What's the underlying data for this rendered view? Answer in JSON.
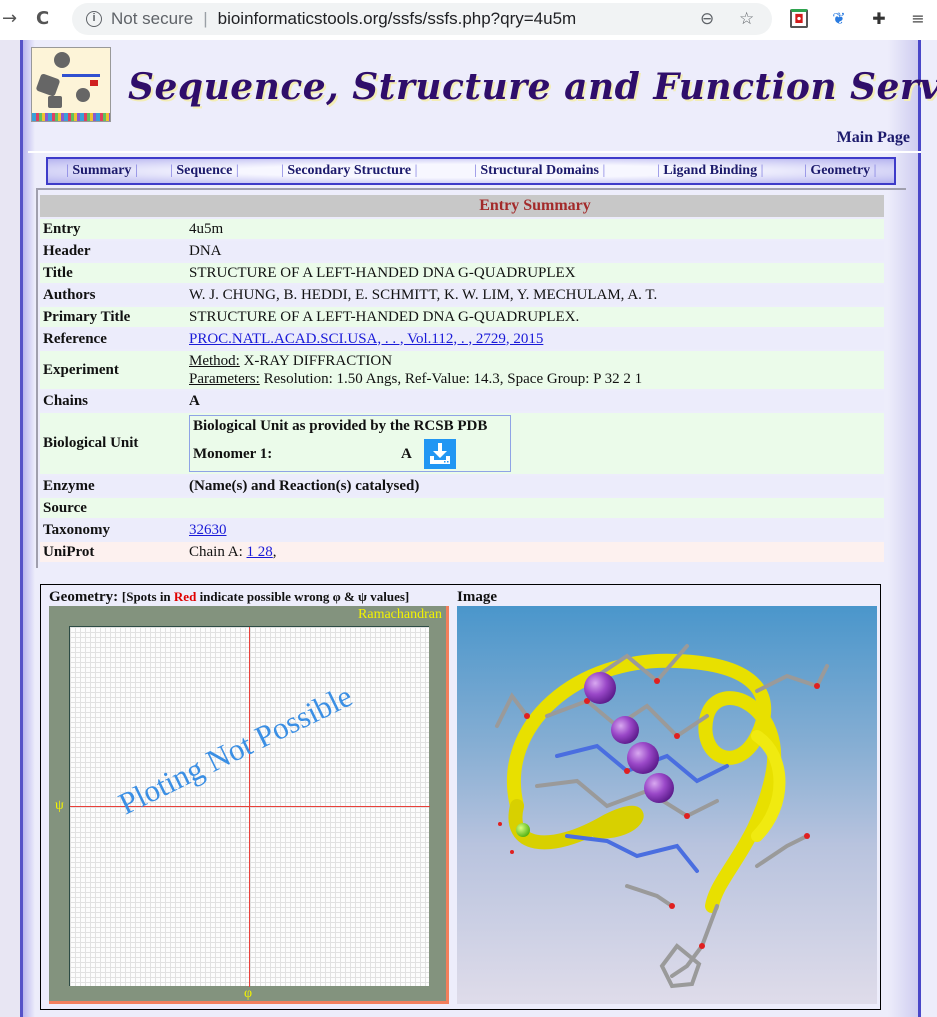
{
  "browser": {
    "back_icon": "→",
    "reload_icon": "C",
    "security_label": "Not secure",
    "url": "bioinformaticstools.org/ssfs/ssfs.php?qry=4u5m",
    "icons": [
      "zoom-out-icon",
      "bookmark-star-icon",
      "mcafee-extension-icon",
      "feather-extension-icon",
      "extensions-puzzle-icon",
      "media-queue-icon"
    ]
  },
  "header": {
    "site_title": "Sequence, Structure and Function Server",
    "main_page_link": "Main Page"
  },
  "nav": {
    "items": [
      {
        "label": "Summary"
      },
      {
        "label": "Sequence"
      },
      {
        "label": "Secondary Structure"
      },
      {
        "label": "Structural Domains"
      },
      {
        "label": "Ligand Binding"
      },
      {
        "label": "Geometry"
      }
    ],
    "separator": "|"
  },
  "summary": {
    "title": "Entry Summary",
    "entry": {
      "label": "Entry",
      "value": "4u5m"
    },
    "header": {
      "label": "Header",
      "value": "DNA"
    },
    "title_row": {
      "label": "Title",
      "value": "STRUCTURE OF A LEFT-HANDED DNA G-QUADRUPLEX"
    },
    "authors": {
      "label": "Authors",
      "value": "W. J. CHUNG, B. HEDDI, E. SCHMITT, K. W. LIM, Y. MECHULAM, A. T."
    },
    "primary_title": {
      "label": "Primary Title",
      "value": "STRUCTURE OF A LEFT-HANDED DNA G-QUADRUPLEX."
    },
    "reference": {
      "label": "Reference",
      "value": "PROC.NATL.ACAD.SCI.USA, . . , Vol.112, . , 2729, 2015"
    },
    "experiment": {
      "label": "Experiment",
      "method_label": "Method:",
      "method_value": "X-RAY DIFFRACTION",
      "params_label": "Parameters:",
      "params_value": "Resolution: 1.50 Angs, Ref-Value: 14.3, Space Group: P 32 2 1"
    },
    "chains": {
      "label": "Chains",
      "value": "A"
    },
    "biological_unit": {
      "label": "Biological Unit",
      "box_title": "Biological Unit as provided by the RCSB PDB",
      "monomer_label": "Monomer 1:",
      "monomer_chain": "A",
      "download_icon": "download-icon"
    },
    "enzyme": {
      "label": "Enzyme",
      "value": "(Name(s) and Reaction(s) catalysed)"
    },
    "source": {
      "label": "Source",
      "value": ""
    },
    "taxonomy": {
      "label": "Taxonomy",
      "value": "32630"
    },
    "uniprot": {
      "label": "UniProt",
      "prefix": "Chain A:",
      "link": "1 28",
      "suffix": ","
    }
  },
  "geometry": {
    "title": "Geometry:",
    "note_prefix": "[Spots in ",
    "note_red": "Red",
    "note_suffix": " indicate possible wrong φ & ψ values]",
    "plot_label": "Ramachandran",
    "x_axis": "φ",
    "y_axis": "ψ",
    "message": "Ploting Not Possible",
    "colors": {
      "background": "#83937e",
      "axis": "#e8403a",
      "label": "#f3f400",
      "message": "#3b8fe4"
    }
  },
  "image_panel": {
    "title": "Image",
    "alt": "3D structure of left-handed DNA G-quadruplex with potassium ions"
  }
}
